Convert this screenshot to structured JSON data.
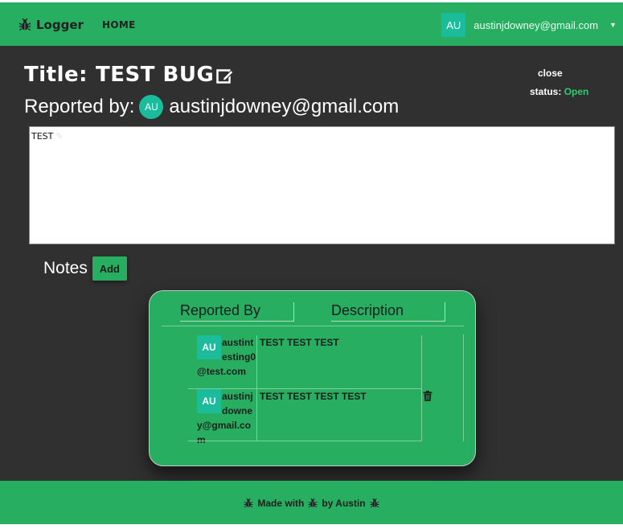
{
  "navbar": {
    "brand": "Logger",
    "home": "HOME",
    "user_initials": "AU",
    "user_email": "austinjdowney@gmail.com",
    "caret": "▼"
  },
  "bug": {
    "title_label": "Title:",
    "title": "TEST BUG",
    "reported_label": "Reported by:",
    "reporter_initials": "AU",
    "reporter_email": "austinjdowney@gmail.com",
    "close_label": "close",
    "status_label": "status:",
    "status_value": "Open",
    "description": "TEST"
  },
  "notes": {
    "title": "Notes",
    "add_label": "Add",
    "columns": [
      "Reported By",
      "Description"
    ],
    "rows": [
      {
        "initials": "AU",
        "reporter": "austintesting0@test.com",
        "text": "TEST TEST TEST",
        "deletable": false
      },
      {
        "initials": "AU",
        "reporter": "austinjdowney@gmail.com",
        "text": "TEST TEST TEST TEST",
        "deletable": true
      }
    ]
  },
  "footer": {
    "prefix": "Made with",
    "suffix": "by Austin"
  },
  "colors": {
    "primary": "#27ae60",
    "background": "#303030",
    "avatar": "#1abc9c",
    "status_open": "#2ecc71"
  },
  "icons": [
    "bug-icon",
    "edit-icon",
    "trash-icon",
    "caret-down-icon"
  ]
}
